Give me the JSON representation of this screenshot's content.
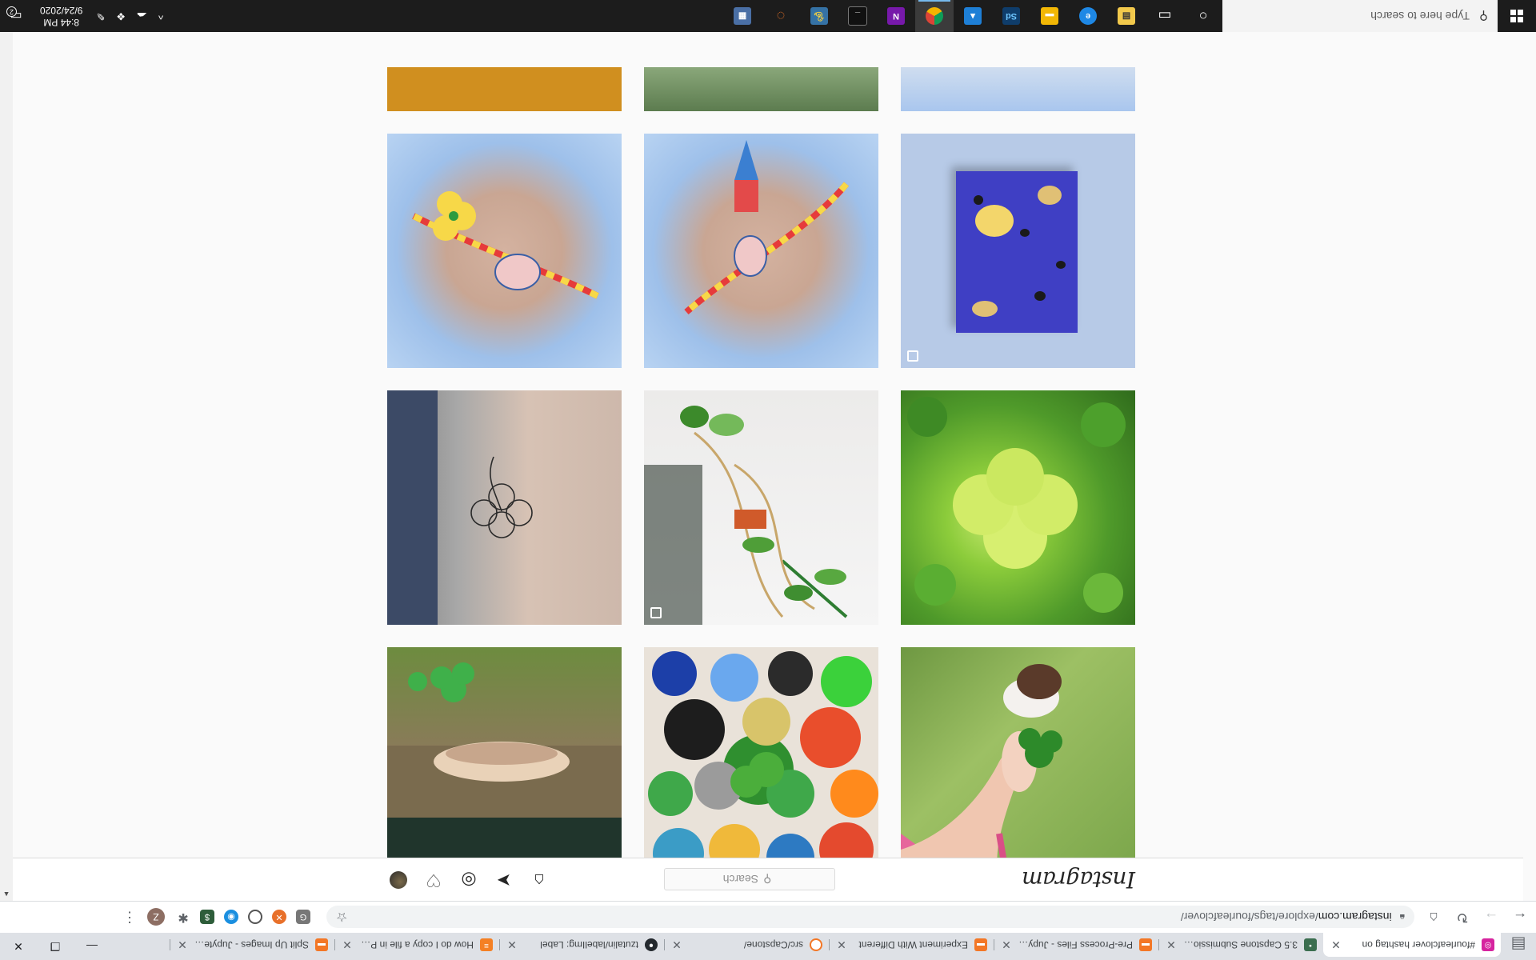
{
  "browser": {
    "tabs": [
      {
        "title": "#fourleafclover hashtag on",
        "favicon": "instagram-icon",
        "color": "#d6249f",
        "active": true
      },
      {
        "title": "3.5 Capstone Submission - ",
        "favicon": "notebook-icon",
        "color": "#3b6e4f",
        "active": false
      },
      {
        "title": "Pre-Process Files - Jupyter",
        "favicon": "jupyter-icon",
        "color": "#f37726",
        "active": false
      },
      {
        "title": "Experiment With Different ",
        "favicon": "jupyter-icon",
        "color": "#f37726",
        "active": false
      },
      {
        "title": "src/Capstone/",
        "favicon": "jupyter-icon",
        "color": "#f37726",
        "active": false
      },
      {
        "title": "tzutalin/labelImg: Label",
        "favicon": "github-icon",
        "color": "#24292e",
        "active": false
      },
      {
        "title": "How do I copy a file in Pyth",
        "favicon": "stackoverflow-icon",
        "color": "#f48024",
        "active": false
      },
      {
        "title": "Split Up Images - Jupyter N",
        "favicon": "jupyter-icon",
        "color": "#f37726",
        "active": false
      }
    ],
    "url": {
      "host": "instagram.com",
      "path": "/explore/tags/fourleafclover/"
    },
    "profile_initial": "Z"
  },
  "instagram": {
    "logo": "Instagram",
    "search_placeholder": "Search"
  },
  "taskbar": {
    "search_placeholder": "Type here to search",
    "apps": [
      {
        "name": "file-explorer-icon",
        "label": "",
        "color": "#f2c94c"
      },
      {
        "name": "edge-icon",
        "label": "",
        "color": "#1e88e5"
      },
      {
        "name": "sticky-folder-icon",
        "label": "",
        "color": "#f2b705"
      },
      {
        "name": "photoshop-icon",
        "label": "Sd",
        "color": "#0f3d6b"
      },
      {
        "name": "photos-icon",
        "label": "",
        "color": "#1e7fd6"
      },
      {
        "name": "chrome-icon",
        "label": "",
        "color": "#4caf50"
      },
      {
        "name": "onenote-icon",
        "label": "N",
        "color": "#7719aa"
      },
      {
        "name": "terminal-icon",
        "label": "",
        "color": "#111111"
      },
      {
        "name": "python-icon",
        "label": "",
        "color": "#3572a5"
      },
      {
        "name": "jupyter-icon",
        "label": "",
        "color": "#f37726"
      },
      {
        "name": "calculator-icon",
        "label": "",
        "color": "#4a6fa5"
      }
    ],
    "time": "8:44 PM",
    "date": "9/24/2020",
    "notifications": "2"
  }
}
